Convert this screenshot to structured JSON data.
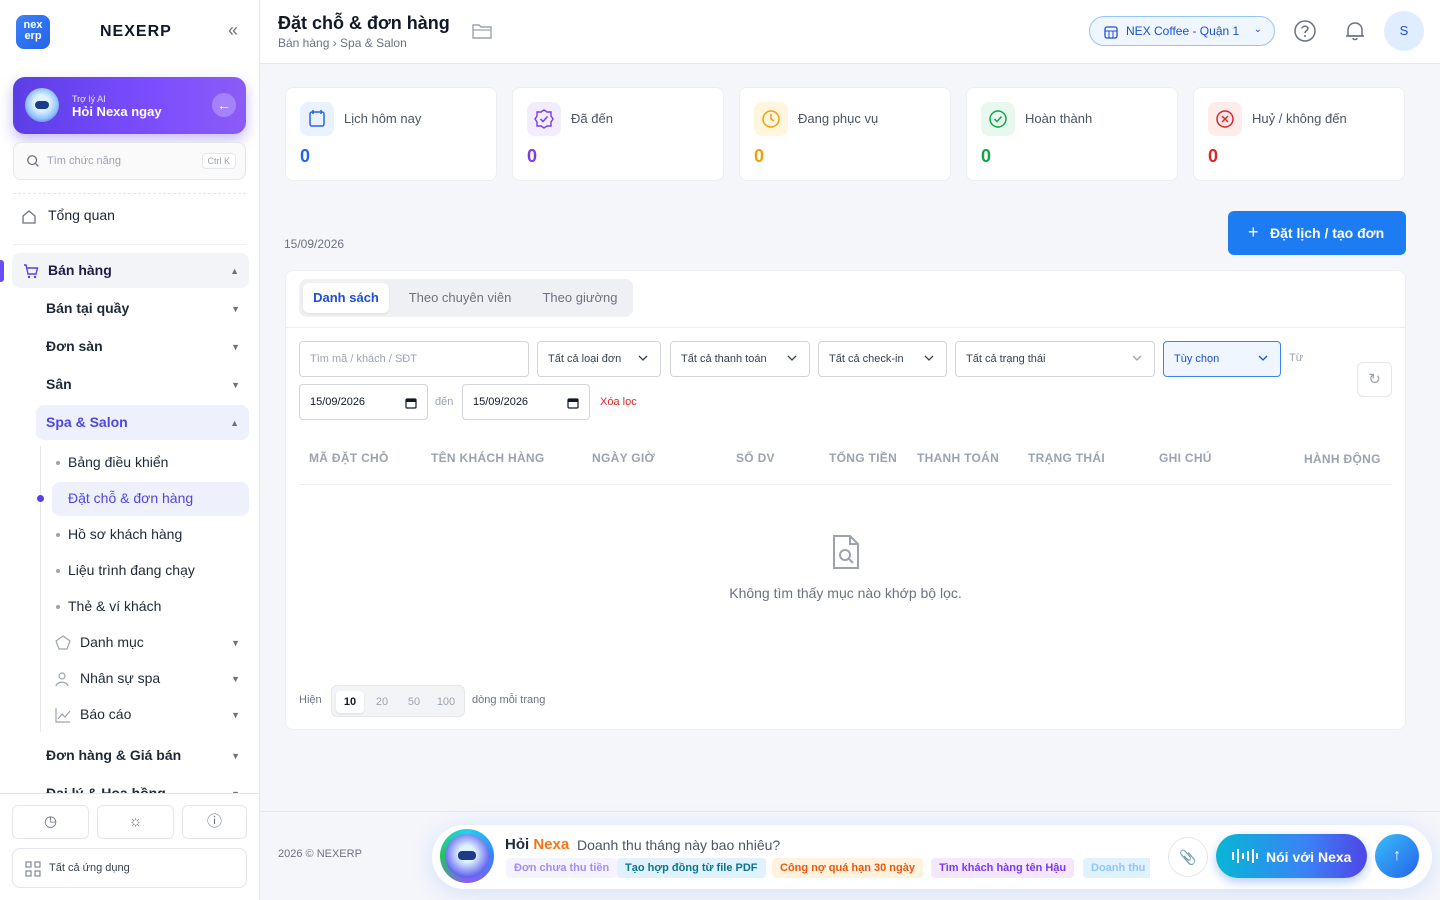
{
  "brand": {
    "logo_top": "nex",
    "logo_bottom": "erp",
    "name": "NEXERP",
    "collapse_icon": "double-chevron-left-icon"
  },
  "ai_card": {
    "small": "Trợ lý AI",
    "big": "Hỏi Nexa ngay"
  },
  "search": {
    "placeholder": "Tìm chức năng",
    "shortcut": "Ctrl K"
  },
  "sidebar": {
    "overview": "Tổng quan",
    "sales": "Bán hàng",
    "pos": "Bán tại quầy",
    "marketplace": "Đơn sàn",
    "court": "Sân",
    "spa": "Spa & Salon",
    "spa_items": [
      "Bảng điều khiển",
      "Đặt chỗ & đơn hàng",
      "Hồ sơ khách hàng",
      "Liệu trình đang chạy",
      "Thẻ & ví khách"
    ],
    "catalog": "Danh mục",
    "staff": "Nhân sự spa",
    "report": "Báo cáo",
    "orders_prices": "Đơn hàng & Giá bán",
    "agents": "Đại lý & Hoa hồng",
    "all_apps": "Tất cả ứng dụng"
  },
  "header": {
    "title": "Đặt chỗ & đơn hàng",
    "breadcrumb": "Bán hàng › Spa & Salon",
    "store": "NEX Coffee - Quận 1",
    "avatar": "S"
  },
  "stats": [
    {
      "label": "Lịch hôm nay",
      "value": "0",
      "color": "#2563eb"
    },
    {
      "label": "Đã đến",
      "value": "0",
      "color": "#7c3aed"
    },
    {
      "label": "Đang phục vụ",
      "value": "0",
      "color": "#f59e0b"
    },
    {
      "label": "Hoàn thành",
      "value": "0",
      "color": "#16a34a"
    },
    {
      "label": "Huỷ / không đến",
      "value": "0",
      "color": "#dc2626"
    }
  ],
  "date_label": "15/09/2026",
  "create_button": "Đặt lịch / tạo đơn",
  "tabs": [
    "Danh sách",
    "Theo chuyên viên",
    "Theo giường"
  ],
  "filters": {
    "search_placeholder": "Tìm mã / khách / SĐT",
    "order_type": "Tất cả loại đơn",
    "payment": "Tất cả thanh toán",
    "checkin": "Tất cả check-in",
    "status": "Tất cả trạng thái",
    "options": "Tùy chọn",
    "from_label": "Từ",
    "date_from": "15/09/2026",
    "to_label": "đến",
    "date_to": "15/09/2026",
    "clear": "Xóa lọc"
  },
  "table": {
    "headers": [
      "MÃ ĐẶT CHỖ",
      "TÊN KHÁCH HÀNG",
      "NGÀY GIỜ",
      "SỐ DV",
      "TỔNG TIỀN",
      "THANH TOÁN",
      "TRẠNG THÁI",
      "GHI CHÚ",
      "HÀNH ĐỘNG"
    ],
    "empty": "Không tìm thấy mục nào khớp bộ lọc."
  },
  "pagination": {
    "show": "Hiện",
    "sizes": [
      "10",
      "20",
      "50",
      "100"
    ],
    "selected": "10",
    "per_page": "dòng mỗi trang"
  },
  "footer": {
    "copyright": "2026 © NEXERP"
  },
  "chat": {
    "title_a": "Hỏi",
    "title_b": "Nexa",
    "question": "Doanh thu tháng này bao nhiêu?",
    "chips": [
      "Đơn chưa thu tiền",
      "Tạo hợp đồng từ file PDF",
      "Công nợ quá hạn 30 ngày",
      "Tìm khách hàng tên Hậu",
      "Doanh thu"
    ],
    "talk": "Nói với Nexa"
  }
}
